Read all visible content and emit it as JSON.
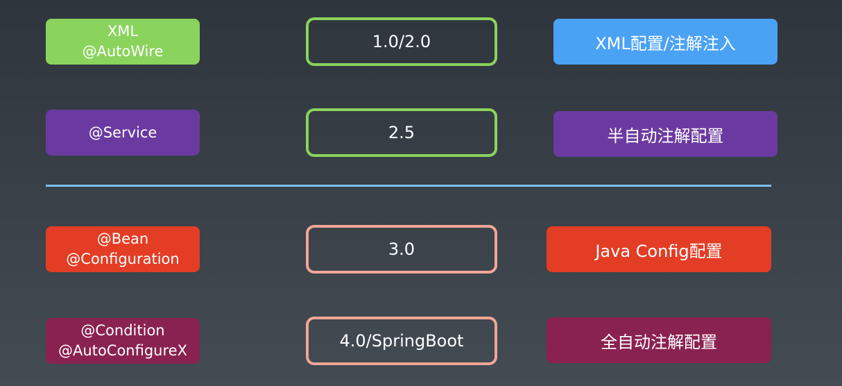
{
  "colors": {
    "green": "#8ad35c",
    "purple": "#6b3aa0",
    "blue": "#4aa2f5",
    "red": "#e33d25",
    "maroon": "#8a2251",
    "green_border": "#8ad35c",
    "salmon_border": "#f2a596",
    "divider": "#7cc0ff"
  },
  "rows": [
    {
      "annotation": "XML\n@AutoWire",
      "version": "1.0/2.0",
      "description": "XML配置/注解注入"
    },
    {
      "annotation": "@Service",
      "version": "2.5",
      "description": "半自动注解配置"
    },
    {
      "annotation": "@Bean\n@Configuration",
      "version": "3.0",
      "description": "Java Config配置"
    },
    {
      "annotation": "@Condition\n@AutoConfigureX",
      "version": "4.0/SpringBoot",
      "description": "全自动注解配置"
    }
  ]
}
